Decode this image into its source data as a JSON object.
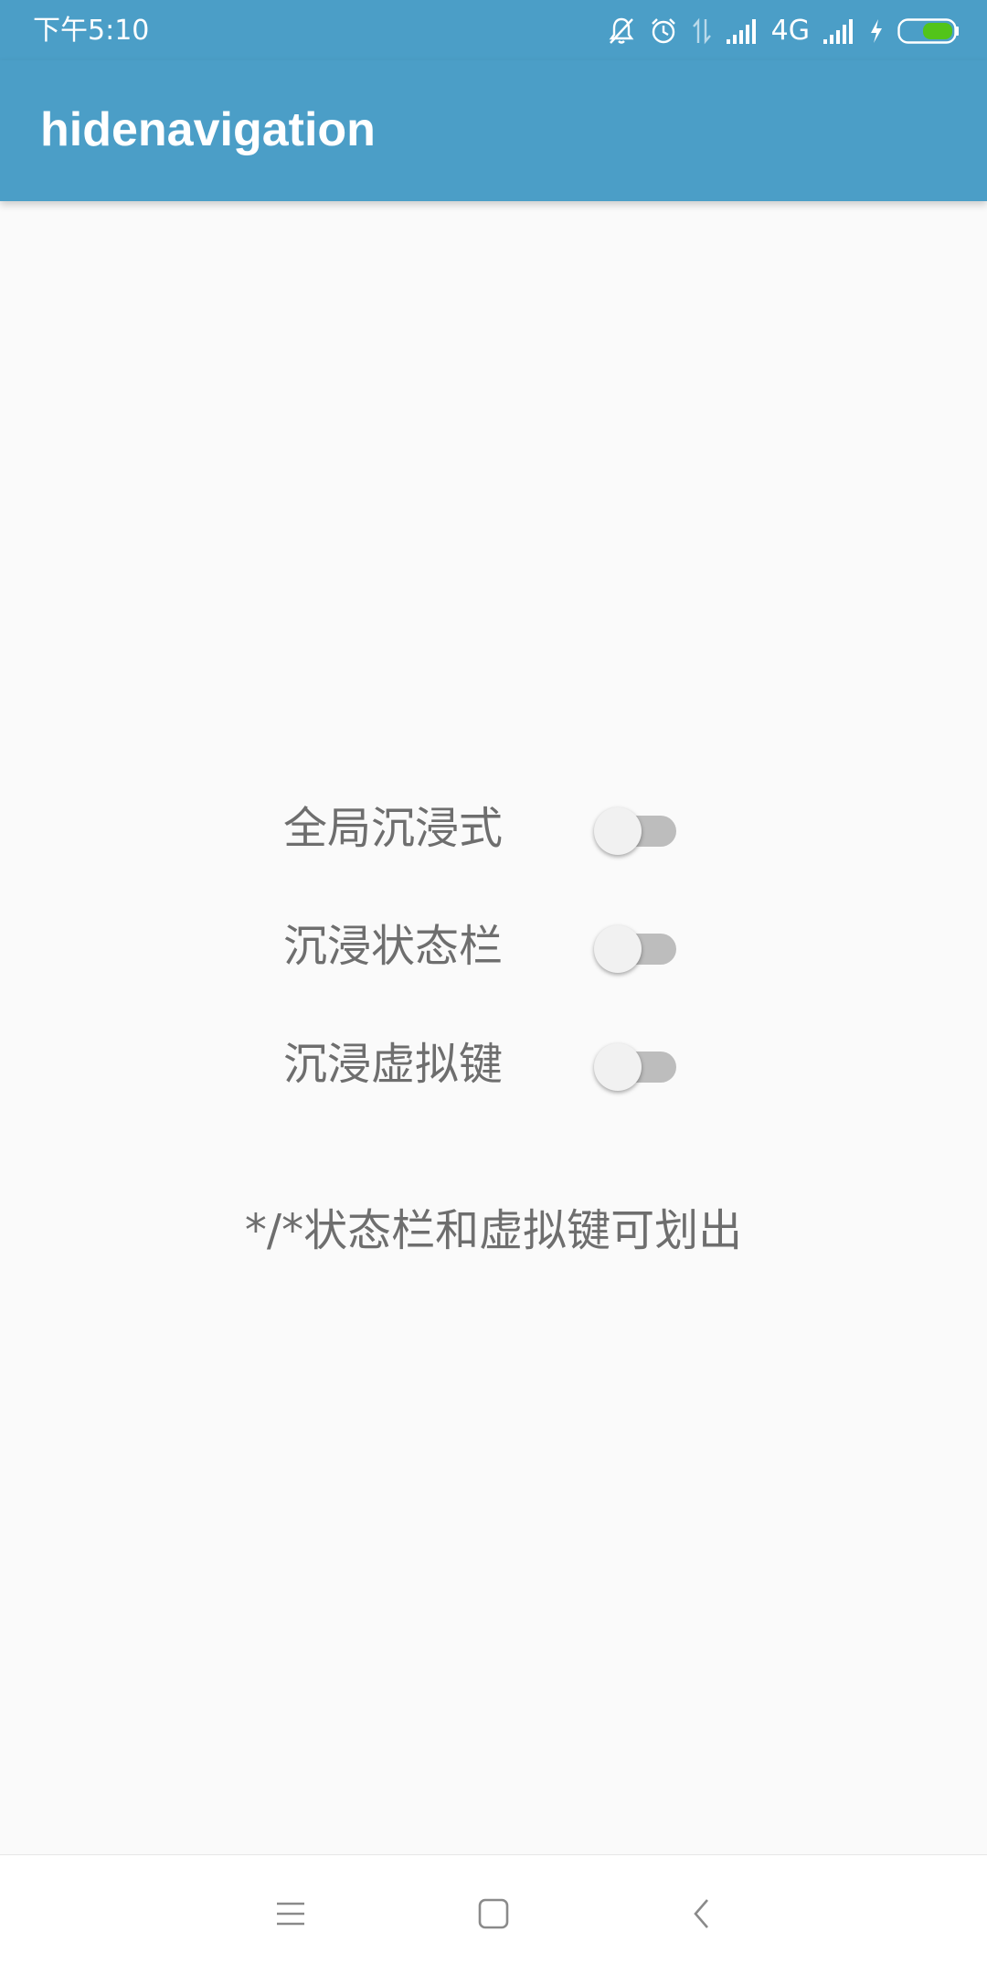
{
  "status_bar": {
    "time": "下午5:10",
    "network_type": "4G",
    "icons": [
      "mute-icon",
      "alarm-icon",
      "data-transfer-icon",
      "signal-icon",
      "signal-icon-2",
      "charging-icon",
      "battery-icon"
    ],
    "background_color": "#4b9ec7",
    "battery_color": "#52c41a"
  },
  "app_bar": {
    "title": "hidenavigation",
    "background_color": "#4b9ec7"
  },
  "settings": {
    "items": [
      {
        "label": "全局沉浸式",
        "checked": false
      },
      {
        "label": "沉浸状态栏",
        "checked": false
      },
      {
        "label": "沉浸虚拟键",
        "checked": false
      }
    ],
    "note": "*/*状态栏和虚拟键可划出"
  },
  "nav_bar": {
    "buttons": [
      "menu-icon",
      "home-icon",
      "back-icon"
    ]
  }
}
